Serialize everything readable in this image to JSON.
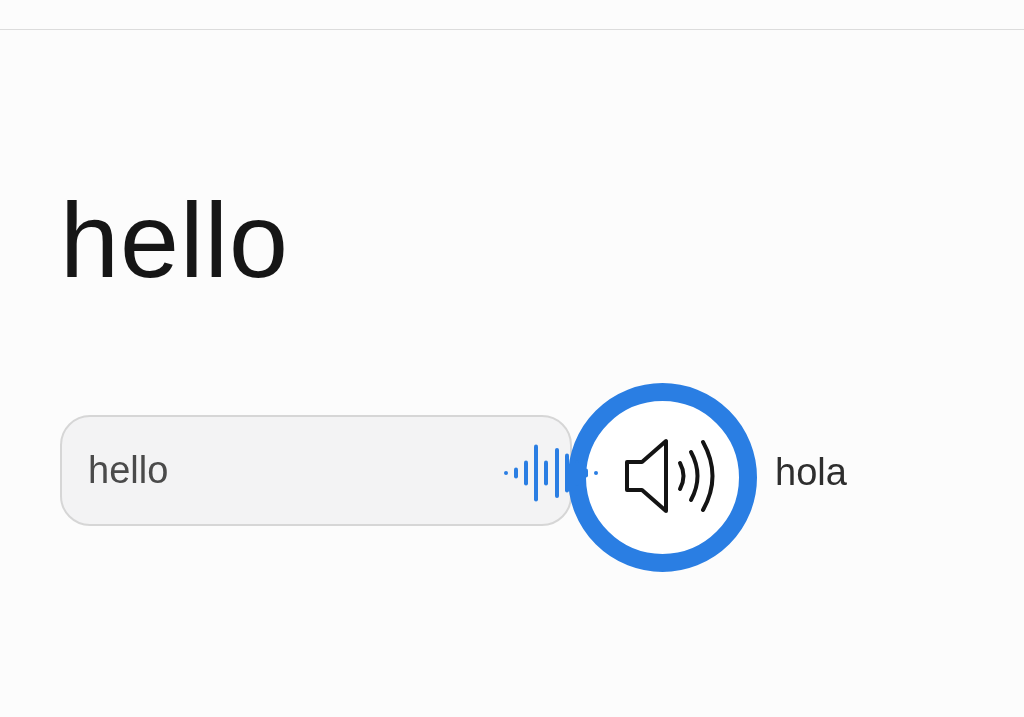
{
  "heading": "hello",
  "input": {
    "value": "hello"
  },
  "speaker_button": {
    "playing": true
  },
  "translation": "hola"
}
